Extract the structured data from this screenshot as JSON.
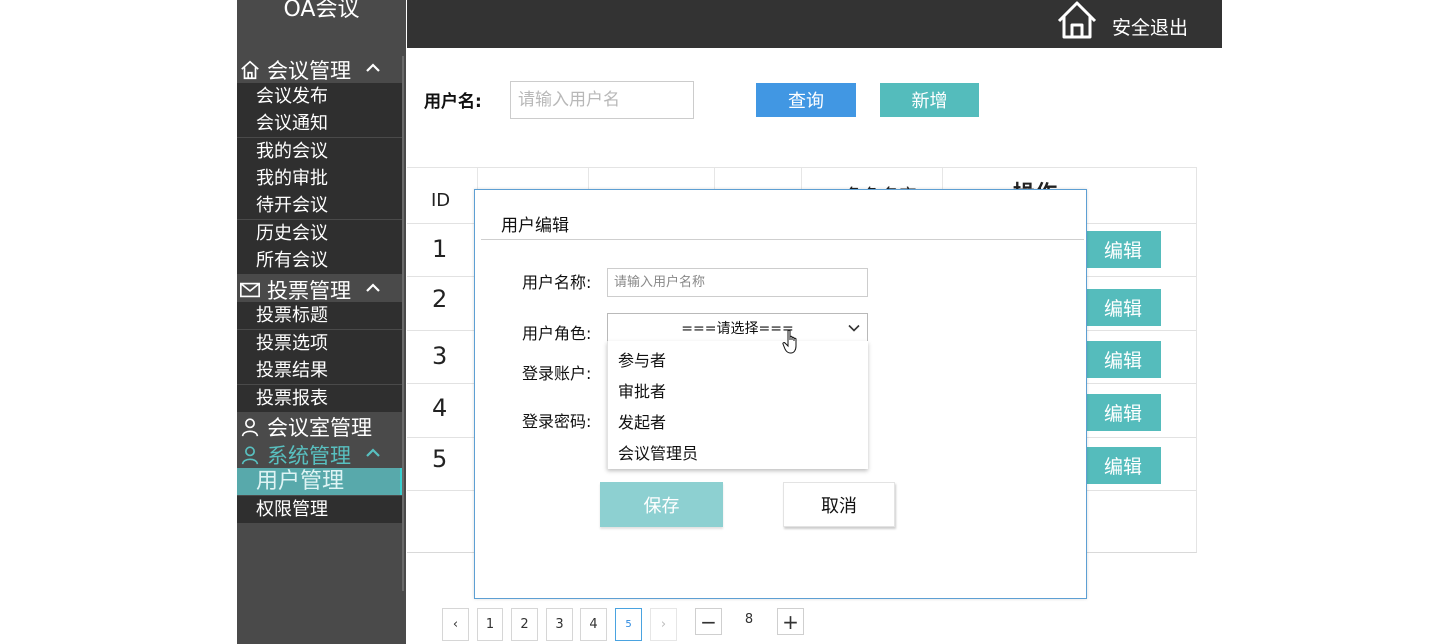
{
  "app": {
    "title": "OA会议"
  },
  "topbar": {
    "logout_label": "安全退出",
    "home_icon": "home-icon"
  },
  "sidebar": {
    "sections": [
      {
        "label": "会议管理",
        "icon": "home-icon",
        "items": [
          "会议发布",
          "会议通知",
          "我的会议",
          "我的审批",
          "待开会议",
          "历史会议",
          "所有会议"
        ]
      },
      {
        "label": "投票管理",
        "icon": "mail-icon",
        "items": [
          "投票标题",
          "投票选项",
          "投票结果",
          "投票报表"
        ]
      },
      {
        "label": "会议室管理",
        "icon": "user-icon",
        "items": []
      },
      {
        "label": "系统管理",
        "icon": "user-icon",
        "items": [
          "用户管理",
          "权限管理"
        ],
        "active_item": "用户管理"
      }
    ]
  },
  "search": {
    "label": "用户名:",
    "placeholder": "请输入用户名",
    "query_label": "查询",
    "add_label": "新增"
  },
  "table": {
    "headers": [
      "ID",
      "",
      "",
      "",
      "角色名字",
      "操作"
    ],
    "rows": [
      {
        "id": "1",
        "action": "编辑"
      },
      {
        "id": "2",
        "action": "编辑"
      },
      {
        "id": "3",
        "action": "编辑"
      },
      {
        "id": "4",
        "action": "编辑"
      },
      {
        "id": "5",
        "action": "编辑"
      }
    ]
  },
  "pagination": {
    "prev": "‹",
    "next": "›",
    "pages": [
      "1",
      "2",
      "3",
      "4",
      "5"
    ],
    "current": "5",
    "minus": "−",
    "plus": "+",
    "page_size": "8"
  },
  "modal": {
    "title": "用户编辑",
    "fields": {
      "name_label": "用户名称:",
      "name_placeholder": "请输入用户名称",
      "role_label": "用户角色:",
      "role_value": "===请选择===",
      "account_label": "登录账户:",
      "password_label": "登录密码:"
    },
    "role_options": [
      "参与者",
      "审批者",
      "发起者",
      "会议管理员"
    ],
    "save_label": "保存",
    "cancel_label": "取消"
  },
  "colors": {
    "sidebar_bg": "#4a4a4a",
    "topbar_bg": "#333333",
    "primary": "#4197e3",
    "accent": "#54bcbc"
  }
}
